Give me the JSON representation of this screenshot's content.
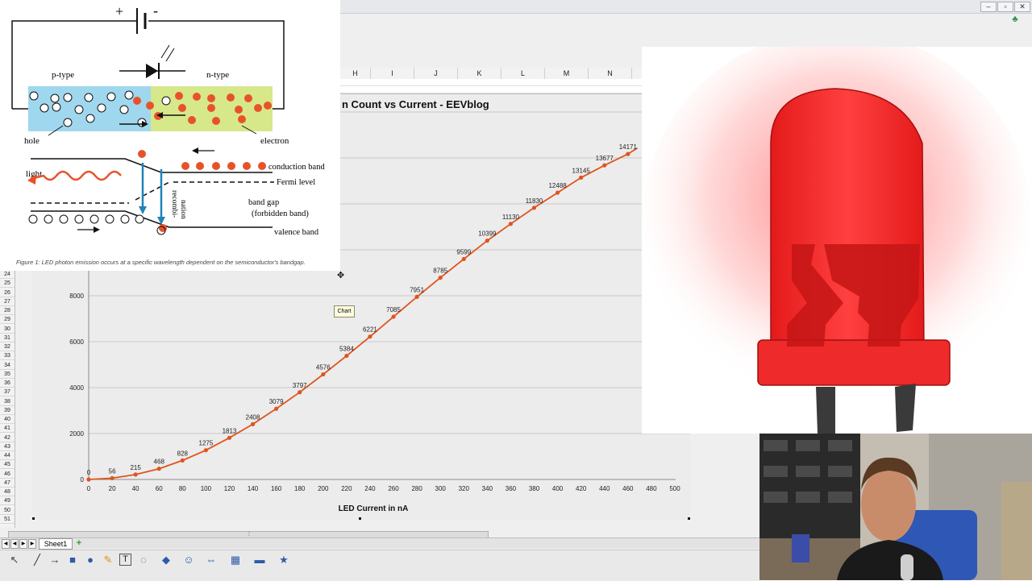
{
  "window": {
    "controls": [
      "–",
      "▫",
      "✕"
    ]
  },
  "spreadsheet": {
    "columns": [
      "H",
      "I",
      "J",
      "K",
      "L",
      "M",
      "N"
    ],
    "rows": [
      "24",
      "25",
      "26",
      "27",
      "28",
      "29",
      "30",
      "31",
      "32",
      "33",
      "34",
      "35",
      "36",
      "37",
      "38",
      "39",
      "40",
      "41",
      "42",
      "43",
      "44",
      "45",
      "46",
      "47",
      "48",
      "49",
      "50",
      "51"
    ],
    "sheet_tab": "Sheet1",
    "add_sheet": "+",
    "tooltip": "Chart"
  },
  "chart_data": {
    "type": "line",
    "title": "Photon Count vs Current - EEVblog",
    "title_visible": "n Count vs Current - EEVblog",
    "xlabel": "LED Current in nA",
    "ylabel": "",
    "x": [
      0,
      20,
      40,
      60,
      80,
      100,
      120,
      140,
      160,
      180,
      200,
      220,
      240,
      260,
      280,
      300,
      320,
      340,
      360,
      380,
      400,
      420,
      440,
      460
    ],
    "values": [
      0,
      56,
      215,
      468,
      828,
      1275,
      1813,
      2408,
      3079,
      3797,
      4576,
      5384,
      6221,
      7085,
      7951,
      8785,
      9599,
      10399,
      11130,
      11830,
      12488,
      13145,
      13677,
      14171
    ],
    "x_ticks": [
      0,
      20,
      40,
      60,
      80,
      100,
      120,
      140,
      160,
      180,
      200,
      220,
      240,
      260,
      280,
      300,
      320,
      340,
      360,
      380,
      400,
      420,
      440,
      460,
      480,
      500
    ],
    "y_ticks": [
      0,
      2000,
      4000,
      6000,
      8000
    ],
    "xlim": [
      0,
      500
    ],
    "grid": true,
    "legend": "none",
    "colors": {
      "line": "#e0541c",
      "grid": "#c8c8c8",
      "background": "#ececec"
    }
  },
  "diagram": {
    "polarity_plus": "+",
    "polarity_minus": "-",
    "p_type": "p-type",
    "n_type": "n-type",
    "hole": "hole",
    "electron": "electron",
    "light": "light",
    "conduction_band": "conduction band",
    "fermi_level": "Fermi level",
    "band_gap": "band gap",
    "forbidden_band": "(forbidden band)",
    "recombination_1": "recombi-",
    "recombination_2": "nation",
    "valence_band": "valence band",
    "caption": "Figure 1: LED photon emission occurs at a specific wavelength dependent on the semiconductor's bandgap.",
    "colors": {
      "p_region": "#9fd8ee",
      "n_region": "#d6e88a",
      "electron": "#e8522a",
      "arrow": "#1f84b8"
    }
  },
  "led": {
    "colors": {
      "body": "#e81d1d",
      "glow": "#ff7b7b",
      "legs": "#3a3a3a"
    }
  },
  "toolbar": {
    "icons": [
      "select-icon",
      "line-icon",
      "arrow-icon",
      "rectangle-icon",
      "ellipse-icon",
      "freeform-icon",
      "text-icon",
      "callout-icon",
      "basic-shapes-icon",
      "symbol-shapes-icon",
      "block-arrows-icon",
      "flowchart-icon",
      "callouts-icon",
      "stars-icon"
    ]
  }
}
